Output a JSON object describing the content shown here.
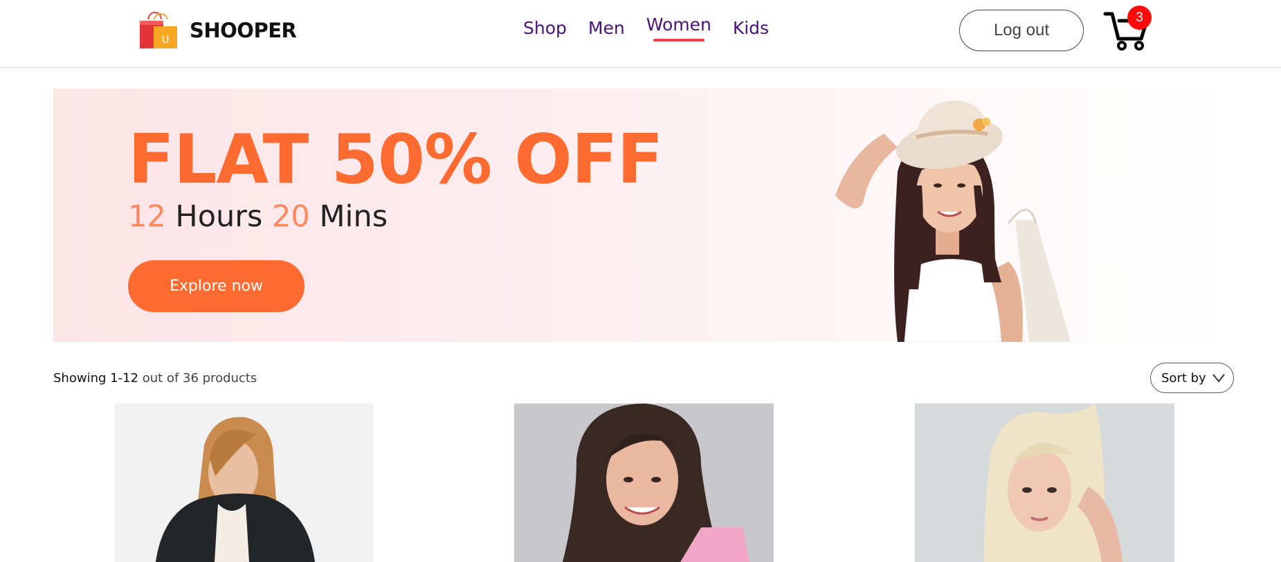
{
  "brand": {
    "name": "SHOOPER",
    "logo_icon": "shopping-bags-icon",
    "logo_letter": "U"
  },
  "nav": {
    "items": [
      {
        "label": "Shop",
        "active": false
      },
      {
        "label": "Men",
        "active": false
      },
      {
        "label": "Women",
        "active": true
      },
      {
        "label": "Kids",
        "active": false
      }
    ],
    "active_color": "#ef3e4a",
    "link_color": "#4b1276"
  },
  "header": {
    "logout_label": "Log out",
    "cart_icon": "cart-icon",
    "cart_count": "3"
  },
  "banner": {
    "title": "FLAT 50% OFF",
    "timer": {
      "hours": "12",
      "hours_label": "Hours",
      "mins": "20",
      "mins_label": "Mins"
    },
    "cta_label": "Explore now",
    "accent_color": "#fe6b30"
  },
  "listing": {
    "showing_prefix": "Showing",
    "range": "1-12",
    "total_text": "out of 36 products",
    "sort_label": "Sort by"
  }
}
